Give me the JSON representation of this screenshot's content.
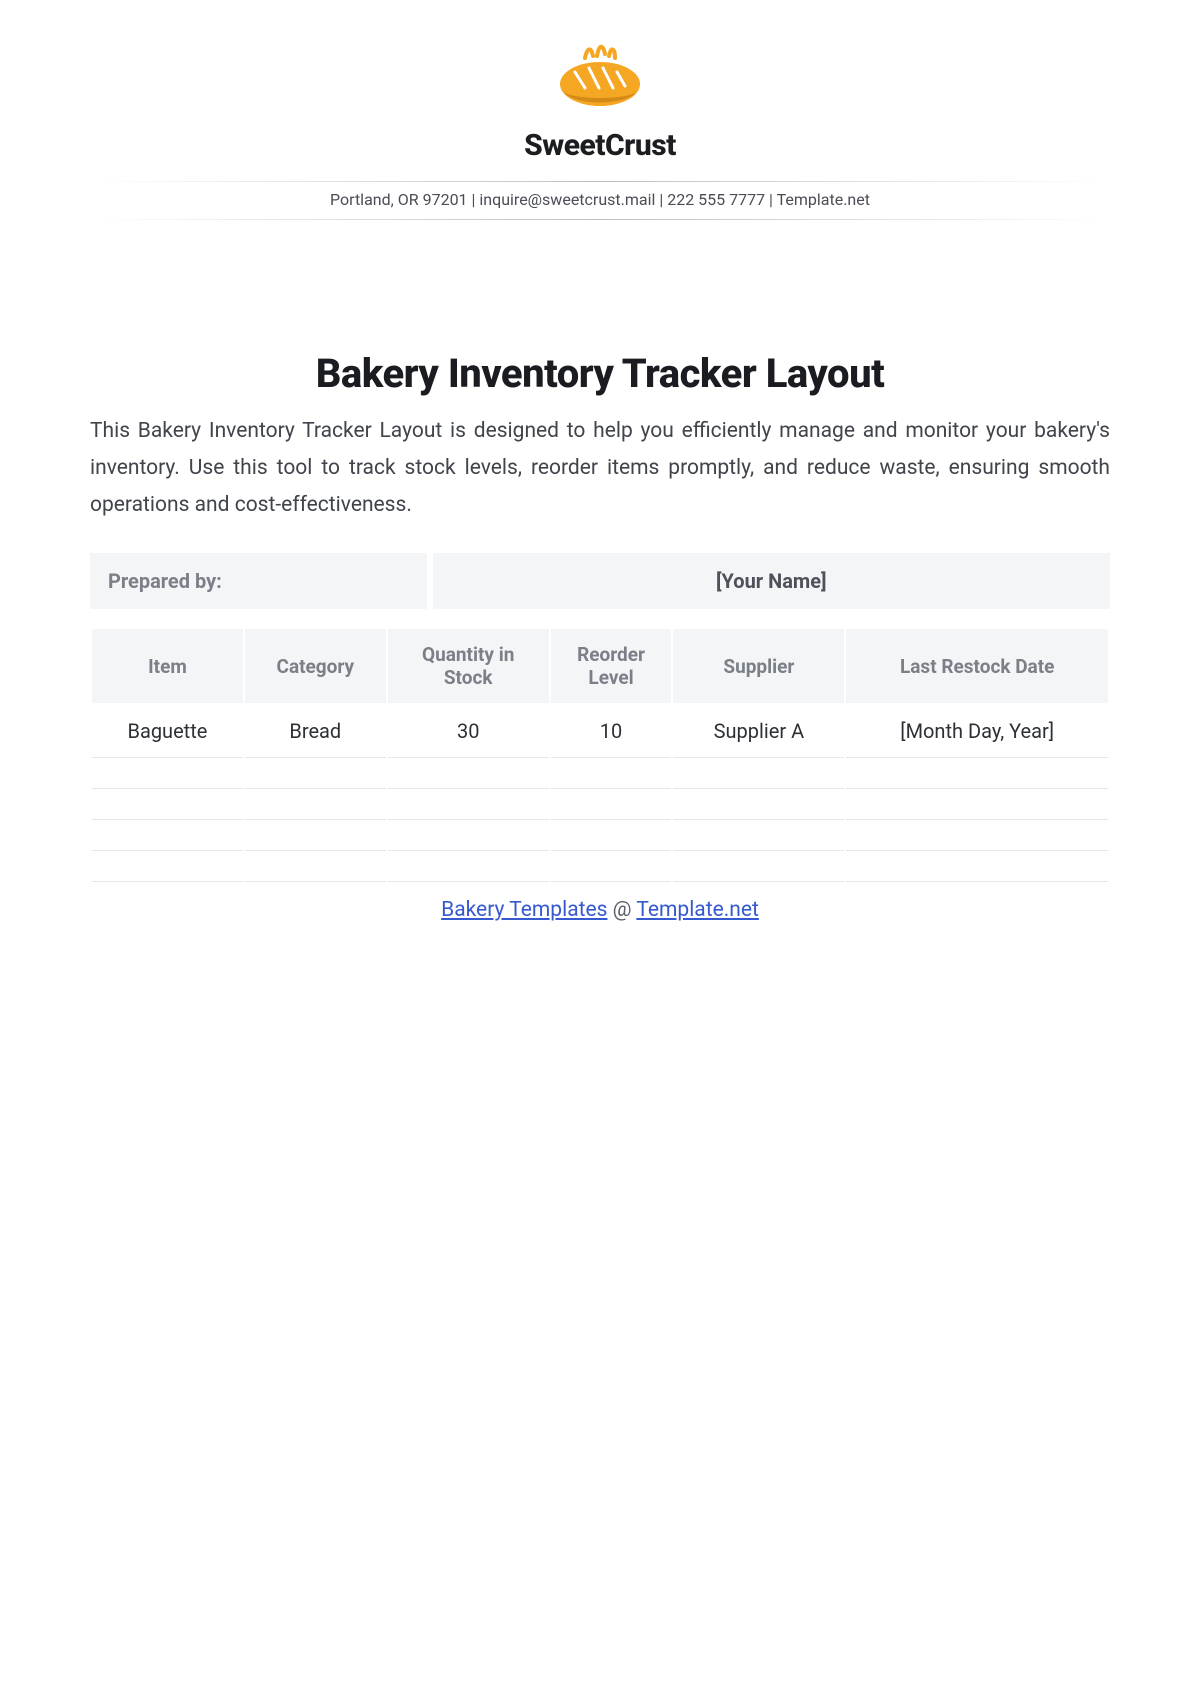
{
  "brand": {
    "name": "SweetCrust"
  },
  "contact": {
    "line": "Portland, OR 97201 | inquire@sweetcrust.mail  | 222 555 7777 | Template.net"
  },
  "title": "Bakery Inventory Tracker Layout",
  "description": "This Bakery Inventory Tracker Layout is designed to help you efficiently manage and monitor your bakery's inventory. Use this tool to track stock levels, reorder items promptly, and reduce waste, ensuring smooth operations and cost-effectiveness.",
  "prepared": {
    "label": "Prepared by:",
    "value": "[Your Name]"
  },
  "table": {
    "headers": {
      "item": "Item",
      "category": "Category",
      "quantity": "Quantity in Stock",
      "reorder": "Reorder Level",
      "supplier": "Supplier",
      "restock": "Last Restock Date"
    },
    "rows": [
      {
        "item": "Baguette",
        "category": "Bread",
        "quantity": "30",
        "reorder": "10",
        "supplier": "Supplier A",
        "restock": "[Month Day, Year]"
      }
    ]
  },
  "footer": {
    "link1": "Bakery Templates",
    "sep": " @ ",
    "link2": "Template.net"
  }
}
